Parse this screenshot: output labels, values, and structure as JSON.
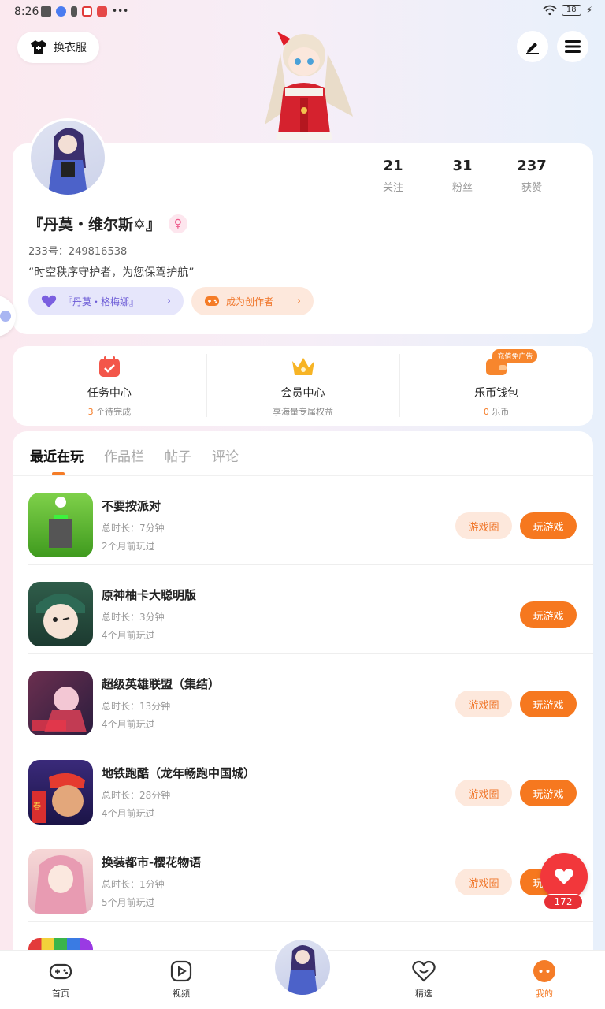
{
  "status_bar": {
    "time": "8:26",
    "battery": "18"
  },
  "header": {
    "outfit_label": "换衣服"
  },
  "profile": {
    "stats": [
      {
        "value": "21",
        "label": "关注"
      },
      {
        "value": "31",
        "label": "粉丝"
      },
      {
        "value": "237",
        "label": "获赞"
      }
    ],
    "name": "『丹莫・维尔斯✡』",
    "uid": "233号：249816538",
    "bio": "“时空秩序守护者，为您保驾护航”",
    "chip_role": "『丹莫・格梅娜』",
    "chip_creator": "成为创作者"
  },
  "services": [
    {
      "title": "任务中心",
      "count": "3",
      "sub": "个待完成"
    },
    {
      "title": "会员中心",
      "sub": "享海量专属权益"
    },
    {
      "title": "乐币钱包",
      "count": "0",
      "sub": "乐币",
      "badge": "充值免广告"
    }
  ],
  "tabs": [
    "最近在玩",
    "作品栏",
    "帖子",
    "评论"
  ],
  "game_labels": {
    "circle": "游戏圈",
    "play": "玩游戏"
  },
  "games": [
    {
      "name": "不要按派对",
      "duration": "总时长：7分钟",
      "last": "2个月前玩过"
    },
    {
      "name": "原神柚卡大聪明版",
      "duration": "总时长：3分钟",
      "last": "4个月前玩过"
    },
    {
      "name": "超级英雄联盟（集结）",
      "duration": "总时长：13分钟",
      "last": "4个月前玩过"
    },
    {
      "name": "地铁跑酷（龙年畅跑中国城）",
      "duration": "总时长：28分钟",
      "last": "4个月前玩过"
    },
    {
      "name": "换装都市-樱花物语",
      "duration": "总时长：1分钟",
      "last": "5个月前玩过"
    }
  ],
  "like_count": "172",
  "nav": [
    "首页",
    "视频",
    "精选",
    "我的"
  ]
}
